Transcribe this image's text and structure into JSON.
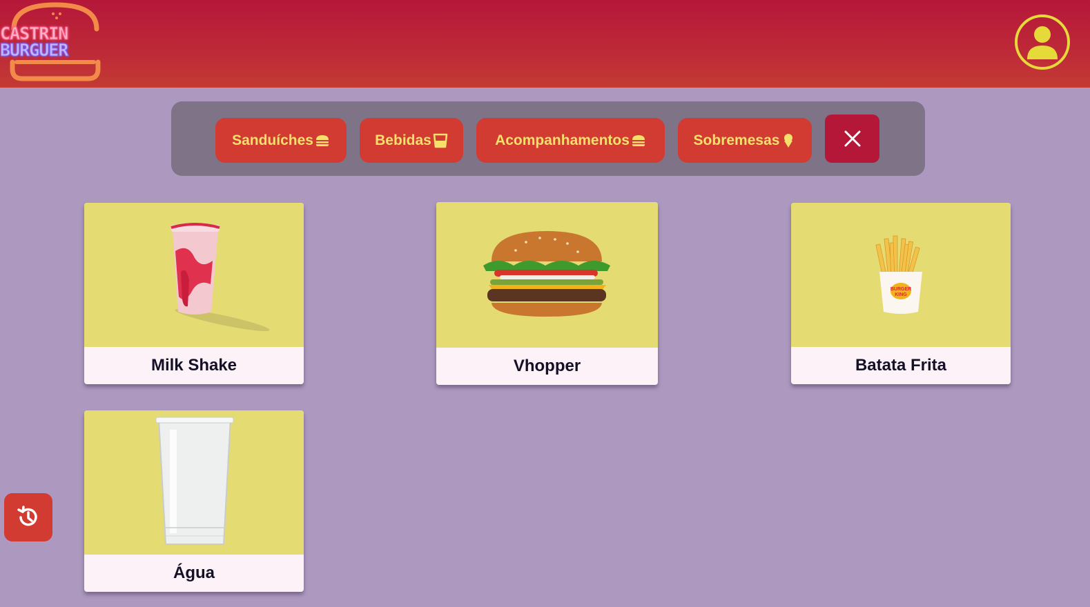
{
  "brand": {
    "line1": "CASTRIN",
    "line2": "BURGUER"
  },
  "header": {
    "profile_icon": "user-circle-icon"
  },
  "categories": [
    {
      "label": "Sanduíches",
      "icon": "burger-icon"
    },
    {
      "label": "Bebidas",
      "icon": "cup-icon"
    },
    {
      "label": "Acompanhamentos",
      "icon": "burger-icon"
    },
    {
      "label": "Sobremesas",
      "icon": "ice-cream-icon"
    }
  ],
  "close_icon": "close-icon",
  "products": [
    {
      "name": "Milk Shake",
      "icon": "milkshake-image"
    },
    {
      "name": "Vhopper",
      "icon": "burger-image"
    },
    {
      "name": "Batata Frita",
      "icon": "fries-image",
      "badge": [
        "BURGER",
        "KING"
      ]
    },
    {
      "name": "Água",
      "icon": "water-glass-image"
    }
  ],
  "history_icon": "history-icon",
  "colors": {
    "header_top": "#b51739",
    "header_bottom": "#c33a33",
    "background": "#ad99bf",
    "panel": "#7f7387",
    "button": "#d13b31",
    "button_text": "#f5e06c",
    "close_button": "#b51739",
    "card_image_bg": "#e5db73",
    "card_label_bg": "#fcf2f8",
    "accent_yellow": "#e6d93a"
  }
}
